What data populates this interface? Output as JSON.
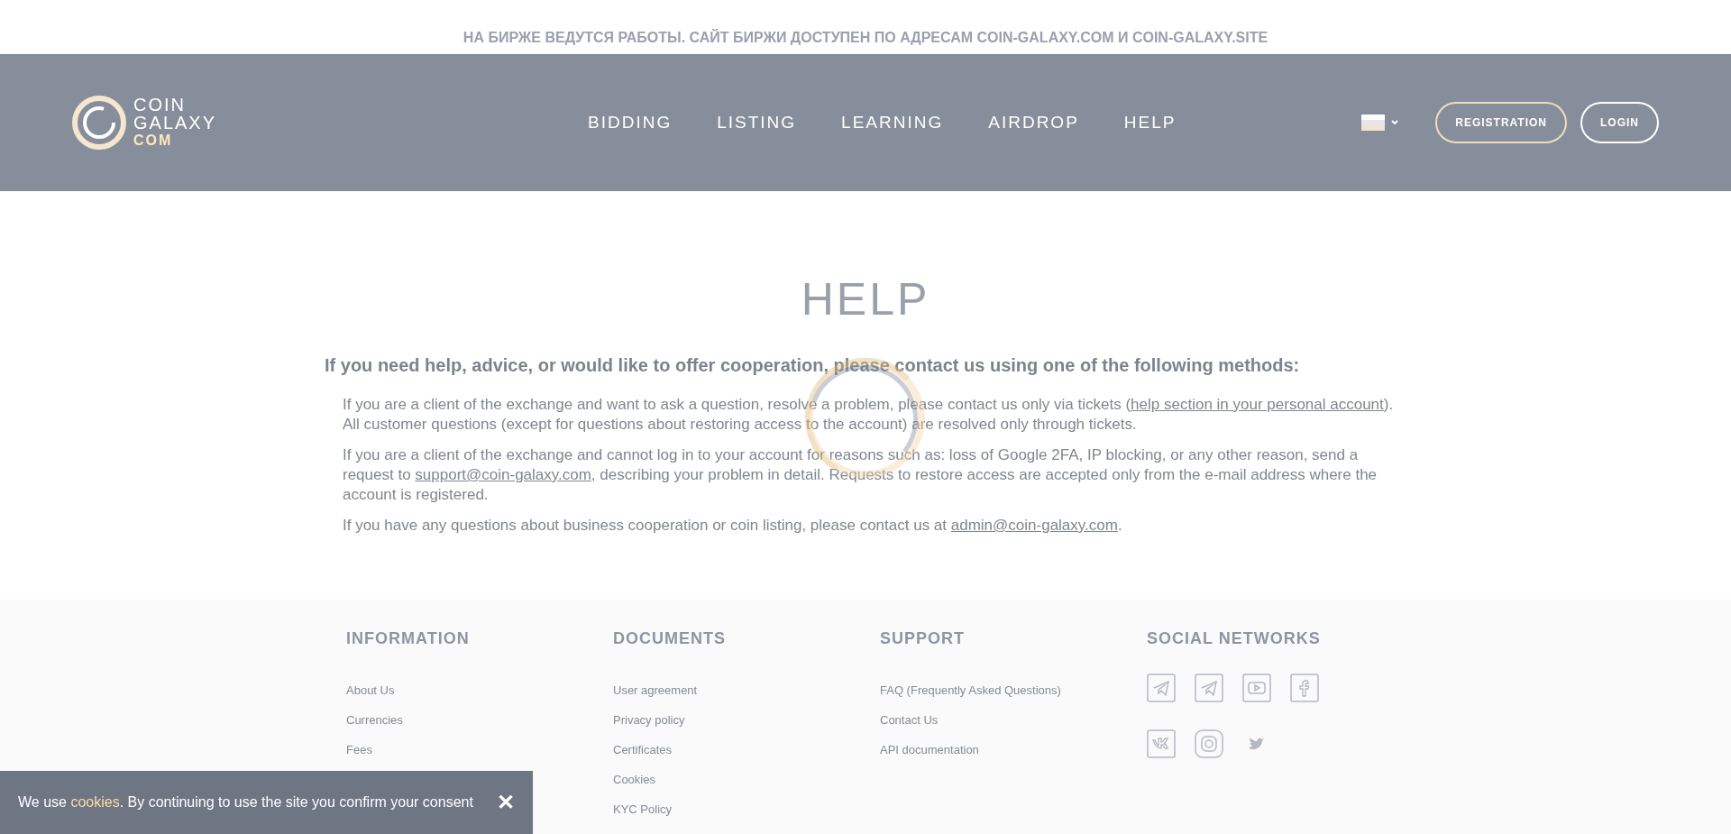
{
  "notice": "НА БИРЖЕ ВЕДУТСЯ РАБОТЫ. САЙТ БИРЖИ ДОСТУПЕН ПО АДРЕСАМ COIN-GALAXY.COM И COIN-GALAXY.SITE",
  "header": {
    "logo": {
      "line1": "COIN",
      "line2": "GALAXY",
      "line3": "COM"
    },
    "nav": [
      "BIDDING",
      "LISTING",
      "LEARNING",
      "AIRDROP",
      "HELP"
    ],
    "buttons": [
      {
        "label": "REGISTRATION",
        "kind": "accent"
      },
      {
        "label": "LOGIN",
        "kind": "plain"
      }
    ]
  },
  "page": {
    "title": "HELP",
    "intro": "If you need help, advice, or would like to offer cooperation, please contact us using one of the following methods:",
    "paragraphs": [
      {
        "before": "If you are a client of the exchange and want to ask a question, resolve a problem, please contact us only via tickets (",
        "link": "help section in your personal account",
        "after": "). All customer questions (except for questions about restoring access to the account) are resolved only through tickets."
      },
      {
        "before": "If you are a client of the exchange and cannot log in to your account for reasons such as: loss of Google 2FA, IP blocking, or any other reason, send a request to ",
        "link": "support@coin-galaxy.com",
        "after": ", describing your problem in detail. Requests to restore access are accepted only from the e-mail address where the account is registered."
      },
      {
        "before": "If you have any questions about business cooperation or coin listing, please contact us at ",
        "link": "admin@coin-galaxy.com",
        "after": "."
      }
    ]
  },
  "footer": {
    "columns": [
      {
        "title": "INFORMATION",
        "links": [
          "About Us",
          "Currencies",
          "Fees"
        ]
      },
      {
        "title": "DOCUMENTS",
        "links": [
          "User agreement",
          "Privacy policy",
          "Certificates",
          "Cookies",
          "KYC Policy"
        ]
      },
      {
        "title": "SUPPORT",
        "links": [
          "FAQ (Frequently Asked Questions)",
          "Contact Us",
          "API documentation"
        ]
      }
    ],
    "social": {
      "title": "SOCIAL NETWORKS"
    }
  },
  "cookie_banner": {
    "text": "We use **cookies**. By continuing to use the site you confirm your consent",
    "close": "✕"
  }
}
